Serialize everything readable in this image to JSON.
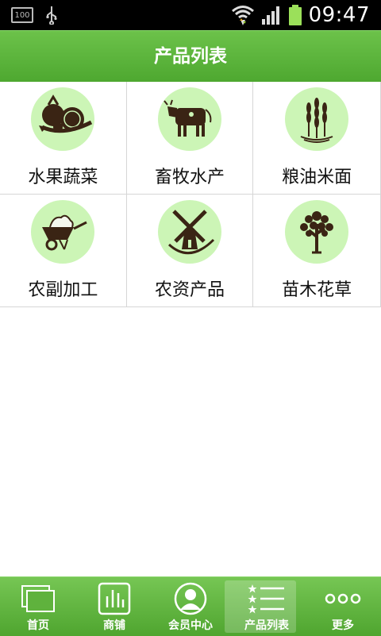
{
  "status_bar": {
    "battery_small_text": "100",
    "time": "09:47"
  },
  "header": {
    "title": "产品列表"
  },
  "categories": [
    {
      "label": "水果蔬菜",
      "icon": "vegetables-icon"
    },
    {
      "label": "畜牧水产",
      "icon": "cow-icon"
    },
    {
      "label": "粮油米面",
      "icon": "wheat-icon"
    },
    {
      "label": "农副加工",
      "icon": "wheelbarrow-icon"
    },
    {
      "label": "农资产品",
      "icon": "windmill-icon"
    },
    {
      "label": "苗木花草",
      "icon": "tree-icon"
    }
  ],
  "tabs": [
    {
      "label": "首页",
      "icon": "home-icon"
    },
    {
      "label": "商铺",
      "icon": "shop-icon"
    },
    {
      "label": "会员中心",
      "icon": "member-icon"
    },
    {
      "label": "产品列表",
      "icon": "list-icon",
      "active": true
    },
    {
      "label": "更多",
      "icon": "more-icon"
    }
  ],
  "colors": {
    "green_accent": "#5bb53a",
    "icon_circle": "#ccf5b6",
    "icon_dark": "#3a2414"
  }
}
